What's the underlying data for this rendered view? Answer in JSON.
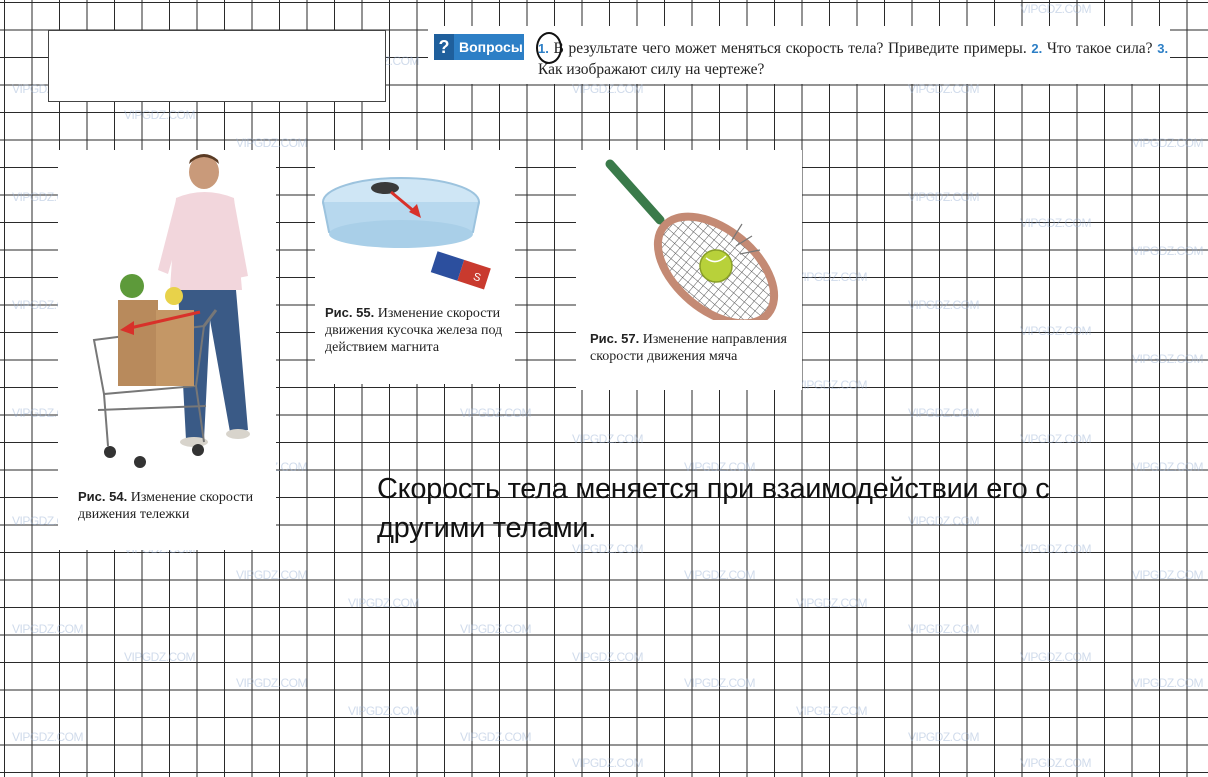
{
  "watermark": "VIPGDZ.COM",
  "questions": {
    "badge_label": "Вопросы",
    "q1_num": "1.",
    "q1_text": "В результате чего может меняться скорость тела? Приведите примеры.",
    "q2_num": "2.",
    "q2_text": "Что такое сила?",
    "q3_num": "3.",
    "q3_text": "Как изображают силу на чертеже?"
  },
  "figures": [
    {
      "label": "Рис. 54.",
      "caption": "Изменение скорости движения тележки"
    },
    {
      "label": "Рис. 55.",
      "caption": "Изменение скорости движения кусочка железа под действием магнита"
    },
    {
      "label": "Рис. 57.",
      "caption": "Изменение направления скорости движения мяча"
    }
  ],
  "answer": {
    "text": "Скорость тела меняется при взаимодействии его с другими телами."
  },
  "colors": {
    "accent": "#2d7fc6",
    "grid": "#2a2a2a"
  }
}
